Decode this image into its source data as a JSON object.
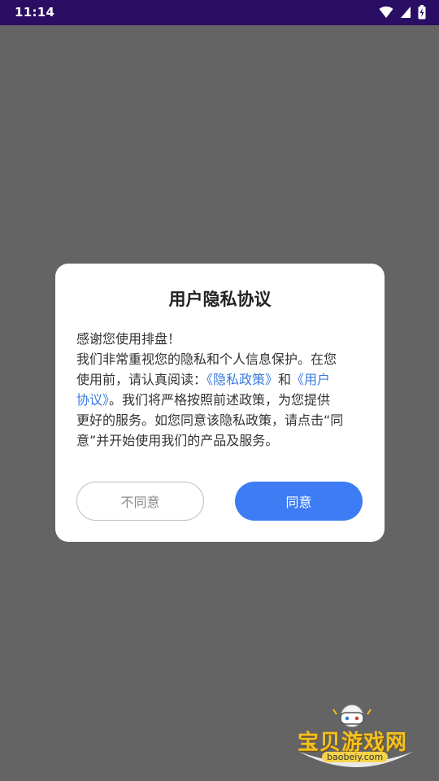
{
  "status_bar": {
    "time": "11:14",
    "icons": [
      "wifi-icon",
      "cellular-signal-icon",
      "battery-charging-icon"
    ]
  },
  "dialog": {
    "title": "用户隐私协议",
    "body_lines": [
      "感谢您使用排盘！",
      "我们非常重视您的隐私和个人信息保护。在您",
      "使用前，请认真阅读：",
      "《隐私政策》",
      "和",
      "《用户",
      "协议》",
      "。我们将严格按照前述政策，为您提供",
      "更好的服务。如您同意该隐私政策，请点击“同",
      "意”并开始使用我们的产品及服务。"
    ],
    "disagree_label": "不同意",
    "agree_label": "同意"
  },
  "watermark": {
    "title": "宝贝游戏网",
    "url": "baobeiy.com"
  },
  "colors": {
    "status_bar": "#2a0e63",
    "overlay": "#646464",
    "link": "#3a7be0",
    "agree_button": "#3d7cf5"
  }
}
